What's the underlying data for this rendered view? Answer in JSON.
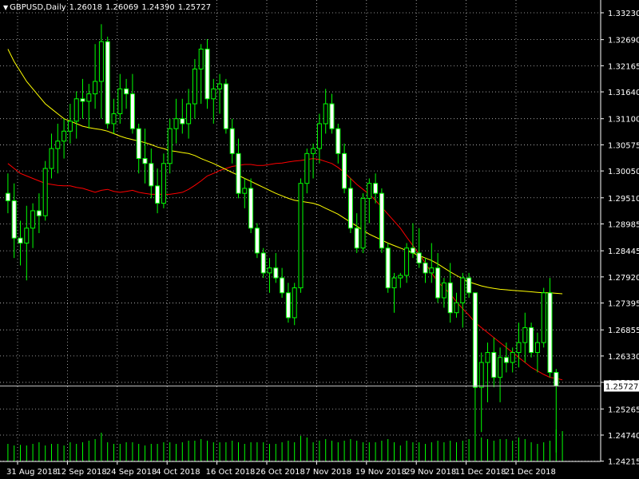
{
  "header": {
    "symbol": "GBPUSD,Daily",
    "open": "1.26018",
    "high": "1.26069",
    "low": "1.24390",
    "close": "1.25727"
  },
  "colors": {
    "background": "#000000",
    "grid": "#c0c0c0",
    "candle": "#00ff00",
    "bull_body": "#000000",
    "bear_body": "#ffffff",
    "ma_fast": "#ff0000",
    "ma_slow": "#ffff00",
    "axis_text": "#ffffff",
    "price_line": "#c0c0c0",
    "volume": "#00ff00"
  },
  "chart_data": {
    "type": "candlestick",
    "title": "GBPUSD,Daily",
    "ylim": [
      1.2421,
      1.3323
    ],
    "y_ticks": [
      "1.33230",
      "1.32690",
      "1.32165",
      "1.31640",
      "1.31100",
      "1.30575",
      "1.30050",
      "1.29510",
      "1.28985",
      "1.28445",
      "1.27920",
      "1.27395",
      "1.26855",
      "1.26330",
      "1.25800",
      "1.25265",
      "1.24740",
      "1.24215"
    ],
    "x_ticks": [
      "31 Aug 2018",
      "12 Sep 2018",
      "24 Sep 2018",
      "4 Oct 2018",
      "16 Oct 2018",
      "26 Oct 2018",
      "7 Nov 2018",
      "19 Nov 2018",
      "29 Nov 2018",
      "11 Dec 2018",
      "21 Dec 2018"
    ],
    "x_tick_bar_index": [
      0,
      8,
      16,
      24,
      32,
      40,
      48,
      56,
      64,
      72,
      80
    ],
    "current_price": "1.25727",
    "candles": [
      [
        1.296,
        1.3,
        1.292,
        1.2945
      ],
      [
        1.2945,
        1.298,
        1.283,
        1.287
      ],
      [
        1.287,
        1.2905,
        1.2815,
        1.286
      ],
      [
        1.286,
        1.2935,
        1.2785,
        1.289
      ],
      [
        1.289,
        1.294,
        1.285,
        1.2925
      ],
      [
        1.2925,
        1.296,
        1.288,
        1.2915
      ],
      [
        1.2915,
        1.3025,
        1.2905,
        1.301
      ],
      [
        1.301,
        1.308,
        1.299,
        1.305
      ],
      [
        1.305,
        1.31,
        1.3,
        1.3065
      ],
      [
        1.3065,
        1.311,
        1.303,
        1.3085
      ],
      [
        1.3085,
        1.314,
        1.306,
        1.3105
      ],
      [
        1.3105,
        1.3165,
        1.307,
        1.315
      ],
      [
        1.315,
        1.319,
        1.311,
        1.3145
      ],
      [
        1.3145,
        1.318,
        1.309,
        1.316
      ],
      [
        1.316,
        1.326,
        1.313,
        1.3185
      ],
      [
        1.3185,
        1.33,
        1.311,
        1.3265
      ],
      [
        1.3265,
        1.3275,
        1.309,
        1.31
      ],
      [
        1.31,
        1.315,
        1.308,
        1.312
      ],
      [
        1.312,
        1.32,
        1.31,
        1.317
      ],
      [
        1.317,
        1.319,
        1.313,
        1.316
      ],
      [
        1.316,
        1.32,
        1.308,
        1.309
      ],
      [
        1.309,
        1.31,
        1.3,
        1.303
      ],
      [
        1.303,
        1.309,
        1.298,
        1.302
      ],
      [
        1.302,
        1.305,
        1.295,
        1.2975
      ],
      [
        1.2975,
        1.301,
        1.292,
        1.294
      ],
      [
        1.294,
        1.304,
        1.293,
        1.302
      ],
      [
        1.302,
        1.311,
        1.3,
        1.309
      ],
      [
        1.309,
        1.315,
        1.306,
        1.311
      ],
      [
        1.311,
        1.315,
        1.308,
        1.31
      ],
      [
        1.31,
        1.317,
        1.307,
        1.314
      ],
      [
        1.314,
        1.323,
        1.311,
        1.321
      ],
      [
        1.321,
        1.326,
        1.314,
        1.325
      ],
      [
        1.325,
        1.327,
        1.313,
        1.315
      ],
      [
        1.315,
        1.319,
        1.31,
        1.317
      ],
      [
        1.317,
        1.32,
        1.312,
        1.318
      ],
      [
        1.318,
        1.319,
        1.308,
        1.309
      ],
      [
        1.309,
        1.311,
        1.302,
        1.304
      ],
      [
        1.304,
        1.307,
        1.295,
        1.296
      ],
      [
        1.296,
        1.299,
        1.293,
        1.297
      ],
      [
        1.297,
        1.299,
        1.288,
        1.289
      ],
      [
        1.289,
        1.29,
        1.283,
        1.284
      ],
      [
        1.284,
        1.285,
        1.279,
        1.28
      ],
      [
        1.28,
        1.283,
        1.276,
        1.281
      ],
      [
        1.281,
        1.284,
        1.278,
        1.279
      ],
      [
        1.279,
        1.281,
        1.275,
        1.276
      ],
      [
        1.276,
        1.278,
        1.27,
        1.271
      ],
      [
        1.271,
        1.278,
        1.2695,
        1.277
      ],
      [
        1.277,
        1.299,
        1.276,
        1.298
      ],
      [
        1.298,
        1.305,
        1.296,
        1.304
      ],
      [
        1.304,
        1.306,
        1.299,
        1.305
      ],
      [
        1.305,
        1.312,
        1.302,
        1.31
      ],
      [
        1.31,
        1.317,
        1.308,
        1.314
      ],
      [
        1.314,
        1.316,
        1.308,
        1.309
      ],
      [
        1.309,
        1.31,
        1.302,
        1.304
      ],
      [
        1.304,
        1.306,
        1.296,
        1.297
      ],
      [
        1.297,
        1.299,
        1.288,
        1.289
      ],
      [
        1.289,
        1.292,
        1.284,
        1.285
      ],
      [
        1.285,
        1.296,
        1.284,
        1.295
      ],
      [
        1.295,
        1.299,
        1.29,
        1.298
      ],
      [
        1.298,
        1.3,
        1.294,
        1.296
      ],
      [
        1.296,
        1.297,
        1.284,
        1.285
      ],
      [
        1.285,
        1.286,
        1.276,
        1.277
      ],
      [
        1.277,
        1.28,
        1.272,
        1.279
      ],
      [
        1.279,
        1.28,
        1.277,
        1.2795
      ],
      [
        1.2795,
        1.286,
        1.278,
        1.285
      ],
      [
        1.285,
        1.29,
        1.283,
        1.284
      ],
      [
        1.284,
        1.289,
        1.281,
        1.282
      ],
      [
        1.282,
        1.283,
        1.278,
        1.28
      ],
      [
        1.28,
        1.286,
        1.278,
        1.281
      ],
      [
        1.281,
        1.284,
        1.274,
        1.275
      ],
      [
        1.275,
        1.279,
        1.273,
        1.278
      ],
      [
        1.278,
        1.282,
        1.27,
        1.272
      ],
      [
        1.272,
        1.276,
        1.271,
        1.274
      ],
      [
        1.274,
        1.28,
        1.269,
        1.279
      ],
      [
        1.279,
        1.28,
        1.275,
        1.276
      ],
      [
        1.276,
        1.276,
        1.248,
        1.257
      ],
      [
        1.257,
        1.264,
        1.248,
        1.262
      ],
      [
        1.262,
        1.266,
        1.254,
        1.264
      ],
      [
        1.264,
        1.267,
        1.257,
        1.259
      ],
      [
        1.259,
        1.265,
        1.254,
        1.263
      ],
      [
        1.263,
        1.266,
        1.26,
        1.262
      ],
      [
        1.262,
        1.265,
        1.26,
        1.264
      ],
      [
        1.264,
        1.27,
        1.261,
        1.266
      ],
      [
        1.266,
        1.272,
        1.262,
        1.269
      ],
      [
        1.269,
        1.27,
        1.263,
        1.264
      ],
      [
        1.264,
        1.268,
        1.26,
        1.266
      ],
      [
        1.266,
        1.277,
        1.265,
        1.276
      ],
      [
        1.276,
        1.279,
        1.259,
        1.26
      ],
      [
        1.26,
        1.2607,
        1.2439,
        1.2573
      ]
    ],
    "ma_red": [
      1.302,
      1.301,
      1.3,
      1.2995,
      1.299,
      1.2985,
      1.298,
      1.2978,
      1.2976,
      1.2975,
      1.2975,
      1.2972,
      1.297,
      1.2966,
      1.2962,
      1.2966,
      1.2968,
      1.2964,
      1.2962,
      1.2964,
      1.2966,
      1.2962,
      1.296,
      1.2958,
      1.2958,
      1.2958,
      1.2958,
      1.296,
      1.2962,
      1.2968,
      1.2976,
      1.2985,
      1.2995,
      1.3,
      1.3006,
      1.301,
      1.3014,
      1.3016,
      1.3018,
      1.3018,
      1.3016,
      1.3016,
      1.3018,
      1.302,
      1.3021,
      1.3023,
      1.3025,
      1.3026,
      1.3028,
      1.303,
      1.3028,
      1.3024,
      1.302,
      1.3012,
      1.3002,
      1.299,
      1.2978,
      1.2968,
      1.2958,
      1.2946,
      1.2932,
      1.2918,
      1.2904,
      1.289,
      1.2872,
      1.2855,
      1.2838,
      1.282,
      1.28,
      1.2782,
      1.277,
      1.2758,
      1.2742,
      1.2728,
      1.2715,
      1.27,
      1.269,
      1.268,
      1.267,
      1.266,
      1.265,
      1.264,
      1.263,
      1.262,
      1.261,
      1.2603,
      1.2596,
      1.259,
      1.2588,
      1.2585
    ],
    "ma_yellow": [
      1.325,
      1.3225,
      1.3205,
      1.3185,
      1.317,
      1.3155,
      1.314,
      1.313,
      1.312,
      1.311,
      1.3105,
      1.31,
      1.3095,
      1.3092,
      1.309,
      1.3088,
      1.3085,
      1.308,
      1.3075,
      1.3071,
      1.3068,
      1.3065,
      1.3062,
      1.3058,
      1.3053,
      1.305,
      1.3046,
      1.3044,
      1.3042,
      1.304,
      1.3036,
      1.303,
      1.3025,
      1.302,
      1.3014,
      1.3008,
      1.3002,
      1.2996,
      1.299,
      1.2984,
      1.2978,
      1.2972,
      1.2966,
      1.296,
      1.2955,
      1.295,
      1.2946,
      1.2944,
      1.2942,
      1.294,
      1.2936,
      1.293,
      1.2924,
      1.2918,
      1.291,
      1.2902,
      1.2894,
      1.2886,
      1.2878,
      1.2872,
      1.2866,
      1.286,
      1.2855,
      1.285,
      1.2845,
      1.284,
      1.2835,
      1.283,
      1.2825,
      1.2818,
      1.281,
      1.2802,
      1.2795,
      1.2788,
      1.2782,
      1.2778,
      1.2774,
      1.2771,
      1.2769,
      1.2767,
      1.2766,
      1.2765,
      1.2764,
      1.2763,
      1.2762,
      1.2761,
      1.276,
      1.276,
      1.2759,
      1.2758
    ],
    "volume": [
      0.55,
      0.5,
      0.52,
      0.5,
      0.55,
      0.6,
      0.5,
      0.55,
      0.55,
      0.5,
      0.6,
      0.55,
      0.6,
      0.65,
      0.7,
      0.9,
      0.6,
      0.55,
      0.55,
      0.6,
      0.6,
      0.55,
      0.5,
      0.55,
      0.55,
      0.6,
      0.6,
      0.55,
      0.6,
      0.65,
      0.65,
      0.7,
      0.65,
      0.6,
      0.6,
      0.6,
      0.65,
      0.6,
      0.55,
      0.6,
      0.6,
      0.6,
      0.55,
      0.55,
      0.6,
      0.65,
      0.6,
      0.8,
      0.75,
      0.6,
      0.65,
      0.7,
      0.65,
      0.6,
      0.65,
      0.7,
      0.65,
      0.6,
      0.6,
      0.6,
      0.65,
      0.7,
      0.6,
      0.5,
      0.65,
      0.6,
      0.6,
      0.55,
      0.6,
      0.65,
      0.6,
      0.65,
      0.6,
      0.65,
      0.7,
      0.95,
      0.75,
      0.7,
      0.65,
      0.7,
      0.7,
      0.65,
      0.75,
      0.7,
      0.6,
      0.55,
      0.6,
      0.65,
      1.0,
      0.95
    ]
  }
}
